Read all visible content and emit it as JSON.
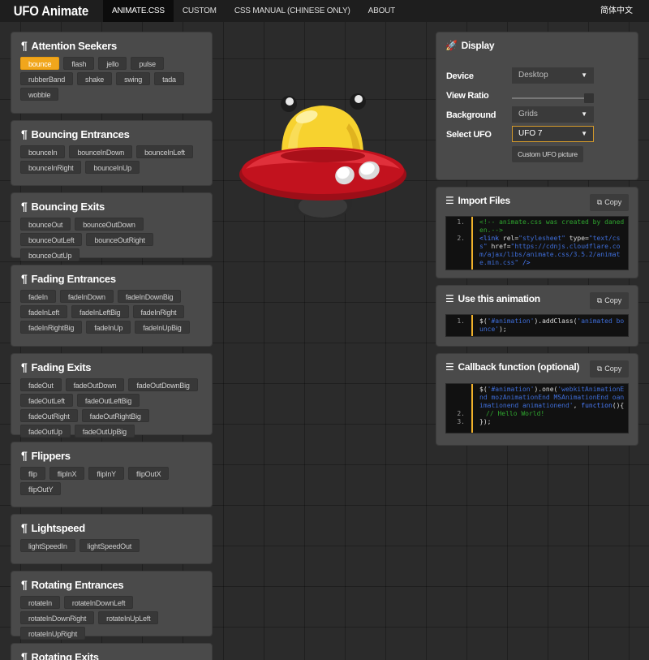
{
  "nav": {
    "brand": "UFO Animate",
    "items": [
      "ANIMATE.CSS",
      "CUSTOM",
      "CSS MANUAL (CHINESE ONLY)",
      "ABOUT"
    ],
    "lang": "简体中文"
  },
  "groups": [
    {
      "title": "Attention Seekers",
      "buttons": [
        "bounce",
        "flash",
        "jello",
        "pulse",
        "rubberBand",
        "shake",
        "swing",
        "tada",
        "wobble"
      ],
      "active": "bounce"
    },
    {
      "title": "Bouncing Entrances",
      "buttons": [
        "bounceIn",
        "bounceInDown",
        "bounceInLeft",
        "bounceInRight",
        "bounceInUp"
      ]
    },
    {
      "title": "Bouncing Exits",
      "buttons": [
        "bounceOut",
        "bounceOutDown",
        "bounceOutLeft",
        "bounceOutRight",
        "bounceOutUp"
      ]
    },
    {
      "title": "Fading Entrances",
      "buttons": [
        "fadeIn",
        "fadeInDown",
        "fadeInDownBig",
        "fadeInLeft",
        "fadeInLeftBig",
        "fadeInRight",
        "fadeInRightBig",
        "fadeInUp",
        "fadeInUpBig"
      ]
    },
    {
      "title": "Fading Exits",
      "buttons": [
        "fadeOut",
        "fadeOutDown",
        "fadeOutDownBig",
        "fadeOutLeft",
        "fadeOutLeftBig",
        "fadeOutRight",
        "fadeOutRightBig",
        "fadeOutUp",
        "fadeOutUpBig"
      ]
    },
    {
      "title": "Flippers",
      "buttons": [
        "flip",
        "flipInX",
        "flipInY",
        "flipOutX",
        "flipOutY"
      ]
    },
    {
      "title": "Lightspeed",
      "buttons": [
        "lightSpeedIn",
        "lightSpeedOut"
      ]
    },
    {
      "title": "Rotating Entrances",
      "buttons": [
        "rotateIn",
        "rotateInDownLeft",
        "rotateInDownRight",
        "rotateInUpLeft",
        "rotateInUpRight"
      ]
    },
    {
      "title": "Rotating Exits",
      "buttons": []
    }
  ],
  "display": {
    "title": "Display",
    "device_label": "Device",
    "device_value": "Desktop",
    "view_ratio_label": "View Ratio",
    "view_ratio_value": 1.0,
    "background_label": "Background",
    "background_value": "Grids",
    "ufo_label": "Select UFO",
    "ufo_value": "UFO 7",
    "custom_button": "Custom UFO picture"
  },
  "import_files": {
    "title": "Import Files",
    "copy": "Copy",
    "lines": [
      "1.",
      "2."
    ]
  },
  "use_animation": {
    "title": "Use this animation",
    "copy": "Copy"
  },
  "callback": {
    "title": "Callback function (optional)",
    "copy": "Copy"
  },
  "code": {
    "import_1": "<!-- animate.css was created by daneden.-->",
    "import_2a": "<link ",
    "import_2b": "rel=",
    "import_2c": "\"stylesheet\"",
    "import_2d": " type=",
    "import_2e": "\"text/css\"",
    "import_2f": " href=",
    "import_2g": "\"https://cdnjs.cloudflare.com/ajax/libs/animate.css/3.5.2/animate.min.css\"",
    "import_2h": " />",
    "use_a": "$(",
    "use_b": "'#animation'",
    "use_c": ").addClass(",
    "use_d": "'animated bounce'",
    "use_e": ");",
    "cb_a": "$(",
    "cb_b": "'#animation'",
    "cb_c": ").one(",
    "cb_d": "'webkitAnimationEnd mozAnimationEnd MSAnimationEnd oanimationend animationend'",
    "cb_e": ",",
    "cb_f": "function",
    "cb_g": "(){",
    "cb_h": "// Hello World!",
    "cb_i": "});"
  },
  "line_numbers": [
    "1.",
    "2.",
    "3."
  ],
  "colors": {
    "accent": "#f1a61c",
    "panel": "#4a4a4a",
    "ufo_dome": "#f7d22f",
    "ufo_saucer": "#c2121e"
  },
  "icons": {
    "title_marker": "pilcrow-icon",
    "display": "rocket-icon",
    "settings": "sliders-icon",
    "copy": "copy-icon"
  }
}
